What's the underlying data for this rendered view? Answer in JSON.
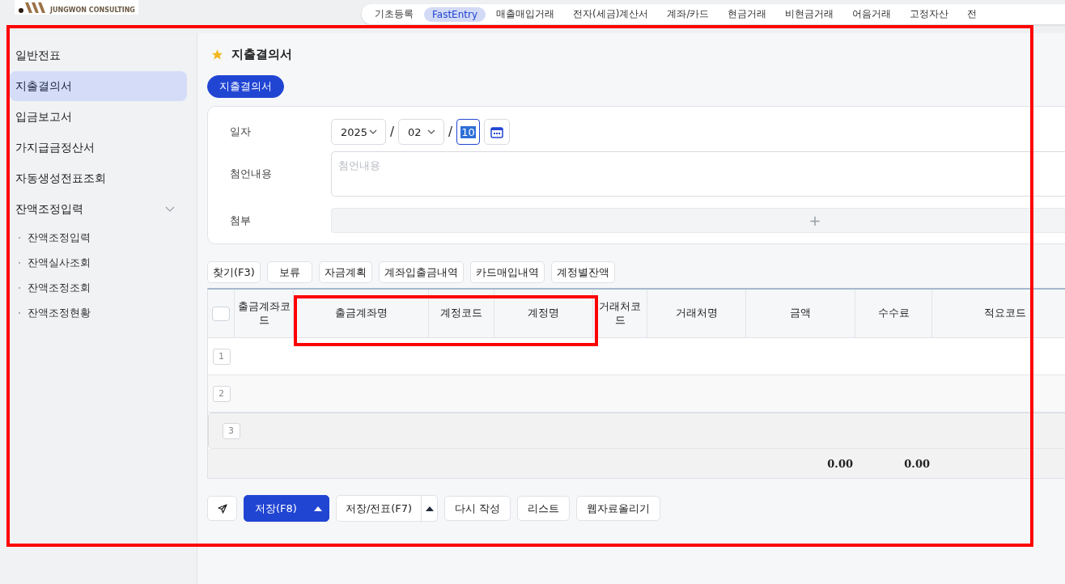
{
  "header": {
    "logo_caption": "JUNGWON CONSULTING",
    "menu_tabs": [
      {
        "label": "기초등록",
        "selected": false
      },
      {
        "label": "FastEntry",
        "selected": true
      },
      {
        "label": "매출매입거래",
        "selected": false
      },
      {
        "label": "전자(세금)계산서",
        "selected": false
      },
      {
        "label": "계좌/카드",
        "selected": false
      },
      {
        "label": "현금거래",
        "selected": false
      },
      {
        "label": "비현금거래",
        "selected": false
      },
      {
        "label": "어음거래",
        "selected": false
      },
      {
        "label": "고정자산",
        "selected": false
      },
      {
        "label": "전",
        "selected": false
      }
    ]
  },
  "sidebar": {
    "items": [
      {
        "label": "일반전표",
        "selected": false
      },
      {
        "label": "지출결의서",
        "selected": true
      },
      {
        "label": "입금보고서",
        "selected": false
      },
      {
        "label": "가지급금정산서",
        "selected": false
      },
      {
        "label": "자동생성전표조회",
        "selected": false
      },
      {
        "label": "잔액조정입력",
        "selected": false,
        "expanded": true,
        "children": [
          {
            "label": "잔액조정입력",
            "selected": false
          },
          {
            "label": "잔액실사조회",
            "selected": false
          },
          {
            "label": "잔액조정조회",
            "selected": false
          },
          {
            "label": "잔액조정현황",
            "selected": false
          }
        ]
      }
    ]
  },
  "page": {
    "title": "지출결의서",
    "favorite": true,
    "tabs": [
      {
        "label": "지출결의서",
        "selected": true
      }
    ]
  },
  "form": {
    "date_label": "일자",
    "year": "2025",
    "month": "02",
    "day": "10",
    "date_separators": [
      "/",
      "/"
    ],
    "comment_label": "첨언내용",
    "comment_placeholder": "첨언내용",
    "attach_label": "첨부",
    "attach_add": "+"
  },
  "toolbar": [
    "찾기(F3)",
    "보류",
    "자금계획",
    "계좌입출금내역",
    "카드매입내역",
    "계정별잔액"
  ],
  "table": {
    "select_all_checked": false,
    "columns": [
      {
        "label": "출금계좌코드"
      },
      {
        "label": "출금계좌명"
      },
      {
        "label": "계정코드"
      },
      {
        "label": "계정명"
      },
      {
        "label": "거래처코드"
      },
      {
        "label": "거래처명"
      },
      {
        "label": "금액"
      },
      {
        "label": "수수료"
      },
      {
        "label": "적요코드"
      }
    ],
    "rows": [
      {
        "number": "1",
        "selected": false
      },
      {
        "number": "2",
        "selected": false
      },
      {
        "number": "3",
        "selected": true
      }
    ],
    "totals": {
      "amount": "0.00",
      "fee": "0.00"
    }
  },
  "actions": [
    {
      "kind": "icon"
    },
    {
      "kind": "primary-split",
      "label": "저장(F8)"
    },
    {
      "kind": "split",
      "label": "저장/전표(F7)"
    },
    {
      "kind": "plain",
      "label": "다시 작성"
    },
    {
      "kind": "plain",
      "label": "리스트"
    },
    {
      "kind": "plain",
      "label": "웹자료올리기"
    }
  ]
}
